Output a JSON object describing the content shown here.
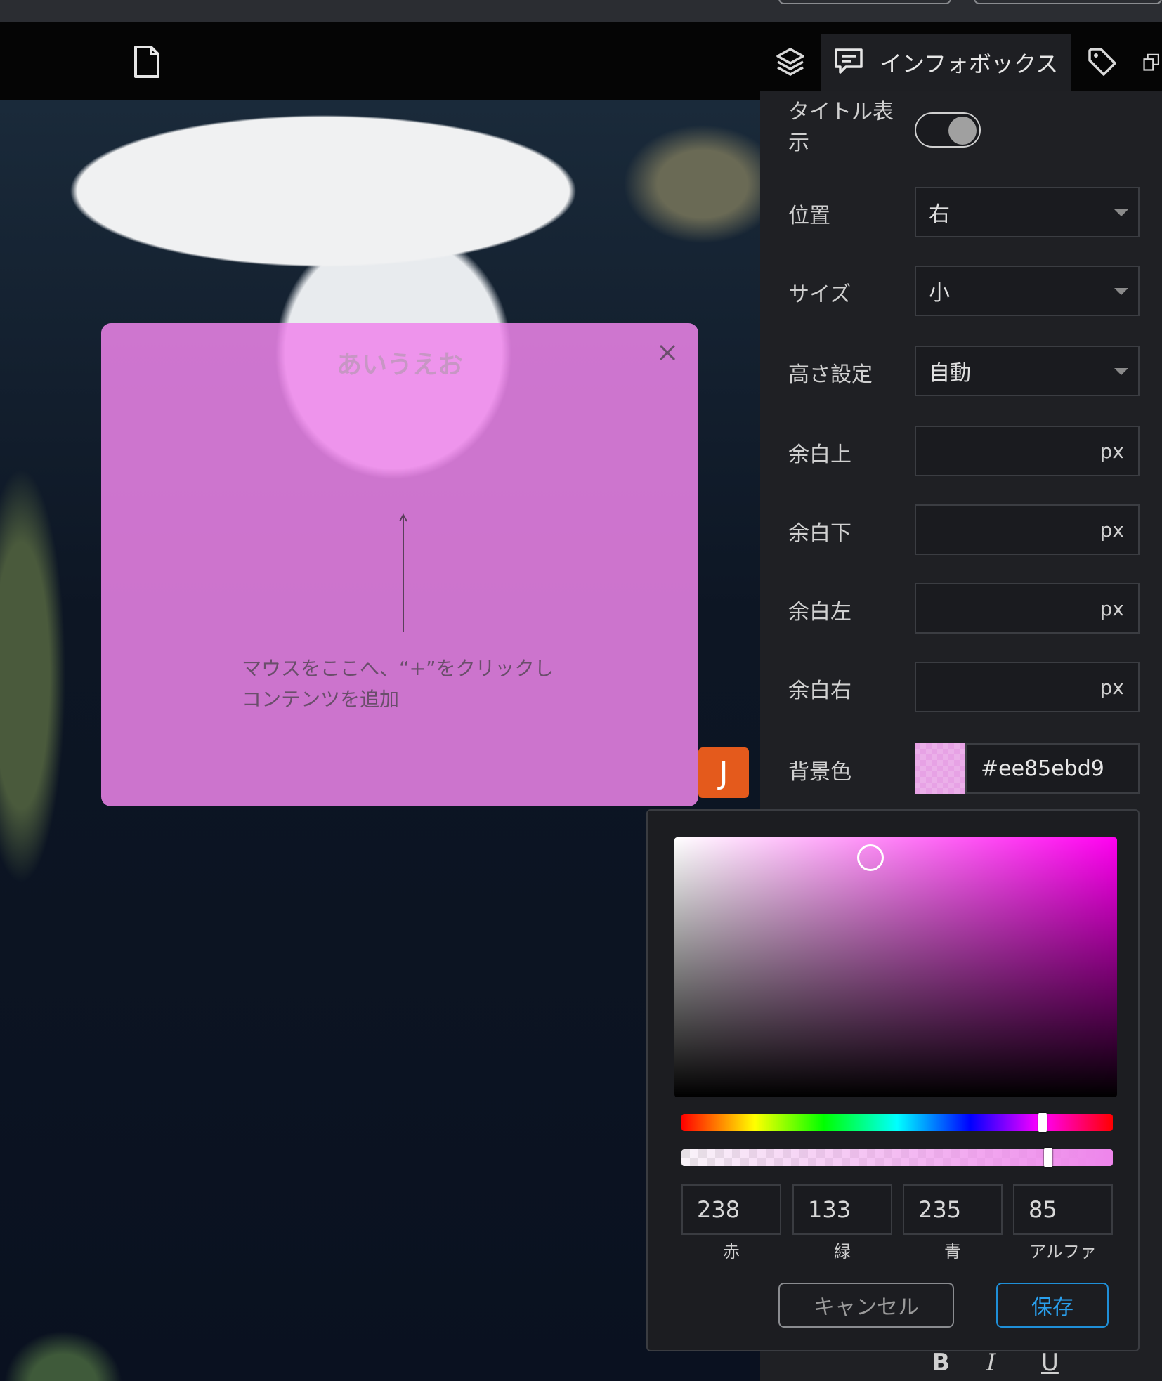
{
  "toolbar": {
    "active_tab_label": "インフォボックス"
  },
  "infobox": {
    "title": "あいうえお",
    "hint_line1": "マウスをここへ、“+”をクリックし",
    "hint_line2": "コンテンツを追加",
    "background_color": "#ee85ebd9"
  },
  "avatar": {
    "initial": "J",
    "color": "#e45a1c"
  },
  "panel": {
    "title_display": {
      "label_line1": "タイトル表",
      "label_line2": "示",
      "enabled": true
    },
    "position": {
      "label": "位置",
      "value": "右"
    },
    "size": {
      "label": "サイズ",
      "value": "小"
    },
    "height": {
      "label": "高さ設定",
      "value": "自動"
    },
    "margin_top": {
      "label": "余白上",
      "unit": "px"
    },
    "margin_bottom": {
      "label": "余白下",
      "unit": "px"
    },
    "margin_left": {
      "label": "余白左",
      "unit": "px"
    },
    "margin_right": {
      "label": "余白右",
      "unit": "px"
    },
    "background": {
      "label": "背景色",
      "value": "#ee85ebd9"
    }
  },
  "color_picker": {
    "red": {
      "value": "238",
      "label": "赤"
    },
    "green": {
      "value": "133",
      "label": "緑"
    },
    "blue": {
      "value": "235",
      "label": "青"
    },
    "alpha": {
      "value": "85",
      "label": "アルファ"
    },
    "hue_fraction": 0.835,
    "alpha_fraction": 0.85,
    "cancel_label": "キャンセル",
    "save_label": "保存"
  },
  "format_bar": {
    "bold": "B",
    "italic": "I",
    "underline": "U"
  }
}
